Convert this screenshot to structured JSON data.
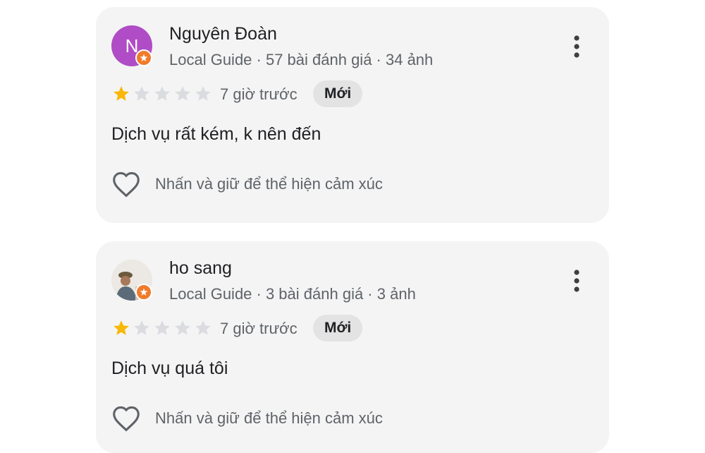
{
  "reviews": [
    {
      "author": "Nguyên Đoàn",
      "avatar_letter": "N",
      "avatar_color": "#b04cc6",
      "meta": "Local Guide · 57 bài đánh giá · 34 ảnh",
      "rating": 1,
      "max_rating": 5,
      "time": "7 giờ trước",
      "badge": "Mới",
      "text": "Dịch vụ rất kém, k nên đến",
      "react_hint": "Nhấn và giữ để thể hiện cảm xúc"
    },
    {
      "author": "ho sang",
      "avatar_letter": "",
      "meta": "Local Guide · 3 bài đánh giá · 3 ảnh",
      "rating": 1,
      "max_rating": 5,
      "time": "7 giờ trước",
      "badge": "Mới",
      "text": "Dịch vụ quá tôi",
      "react_hint": "Nhấn và giữ để thể hiện cảm xúc"
    }
  ],
  "icons": {
    "more": "more-vert-icon",
    "like": "heart-outline-icon",
    "star": "star-icon",
    "local_guide": "local-guide-badge-icon"
  },
  "colors": {
    "star_filled": "#f9b707",
    "star_empty": "#dadce0",
    "local_guide_badge": "#f07b2b"
  }
}
